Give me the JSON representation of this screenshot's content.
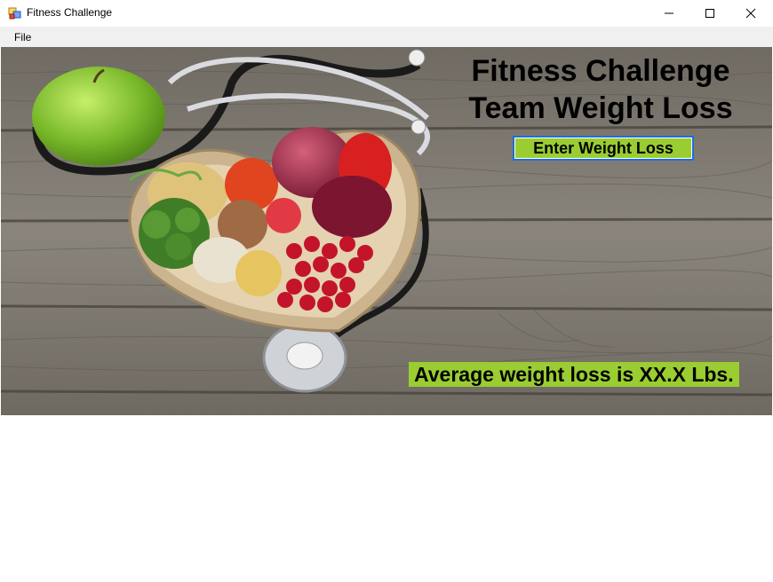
{
  "window": {
    "title": "Fitness Challenge",
    "minimize_icon": "minimize-icon",
    "maximize_icon": "maximize-icon",
    "close_icon": "close-icon"
  },
  "menu": {
    "items": [
      {
        "label": "File"
      }
    ]
  },
  "main": {
    "headline_line1": "Fitness Challenge",
    "headline_line2": "Team Weight Loss",
    "enter_button_label": "Enter Weight Loss",
    "average_label": "Average weight loss is XX.X Lbs.",
    "accent_color": "#9acd32",
    "background_image": "wooden-table-with-heart-bowl-of-vegetables-and-stethoscope"
  }
}
